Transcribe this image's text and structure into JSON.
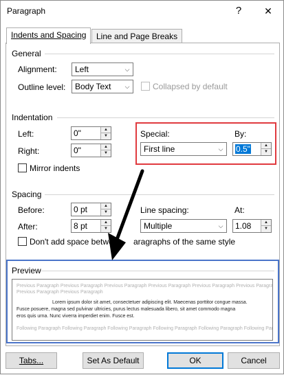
{
  "window": {
    "title": "Paragraph",
    "help_glyph": "?",
    "close_glyph": "✕"
  },
  "tabs": [
    {
      "label": "Indents and Spacing",
      "active": true
    },
    {
      "label": "Line and Page Breaks",
      "active": false
    }
  ],
  "general": {
    "heading": "General",
    "alignment_label": "Alignment:",
    "alignment_value": "Left",
    "outline_label": "Outline level:",
    "outline_value": "Body Text",
    "collapsed_label": "Collapsed by default",
    "collapsed_checked": false,
    "collapsed_enabled": false
  },
  "indentation": {
    "heading": "Indentation",
    "left_label": "Left:",
    "left_value": "0\"",
    "right_label": "Right:",
    "right_value": "0\"",
    "mirror_label": "Mirror indents",
    "mirror_checked": false,
    "special_label": "Special:",
    "special_value": "First line",
    "by_label": "By:",
    "by_value": "0.5\""
  },
  "spacing": {
    "heading": "Spacing",
    "before_label": "Before:",
    "before_value": "0 pt",
    "after_label": "After:",
    "after_value": "8 pt",
    "line_spacing_label": "Line spacing:",
    "line_spacing_value": "Multiple",
    "at_label": "At:",
    "at_value": "1.08",
    "dont_add_label_a": "Don't add space betwe",
    "dont_add_label_b": "aragraphs of the same style",
    "dont_add_checked": false
  },
  "preview": {
    "heading": "Preview",
    "previous_text": "Previous Paragraph Previous Paragraph Previous Paragraph Previous Paragraph Previous Paragraph Previous Paragraph Previous Paragraph",
    "previous_text_2": "Previous Paragraph Previous Paragraph",
    "main_line_1": "Lorem ipsum dolor sit amet, consectetuer adipiscing elit. Maecenas porttitor congue massa.",
    "main_line_2": "Fusce posuere, magna sed pulvinar ultricies, purus lectus malesuada libero, sit amet commodo magna",
    "main_line_3": "eros quis urna. Nunc viverra imperdiet enim. Fusce est.",
    "following_text": "Following Paragraph Following Paragraph Following Paragraph Following Paragraph Following Paragraph Following Paragraph"
  },
  "buttons": {
    "tabs": "Tabs...",
    "set_default": "Set As Default",
    "ok": "OK",
    "cancel": "Cancel"
  },
  "colors": {
    "accent": "#0078d7",
    "annotation_red": "#e0393e",
    "annotation_blue": "#4a74c9",
    "arrow": "#000000"
  },
  "icons": {
    "dropdown": "chevron-down-icon",
    "spin_up": "spin-up-icon",
    "spin_down": "spin-down-icon"
  }
}
